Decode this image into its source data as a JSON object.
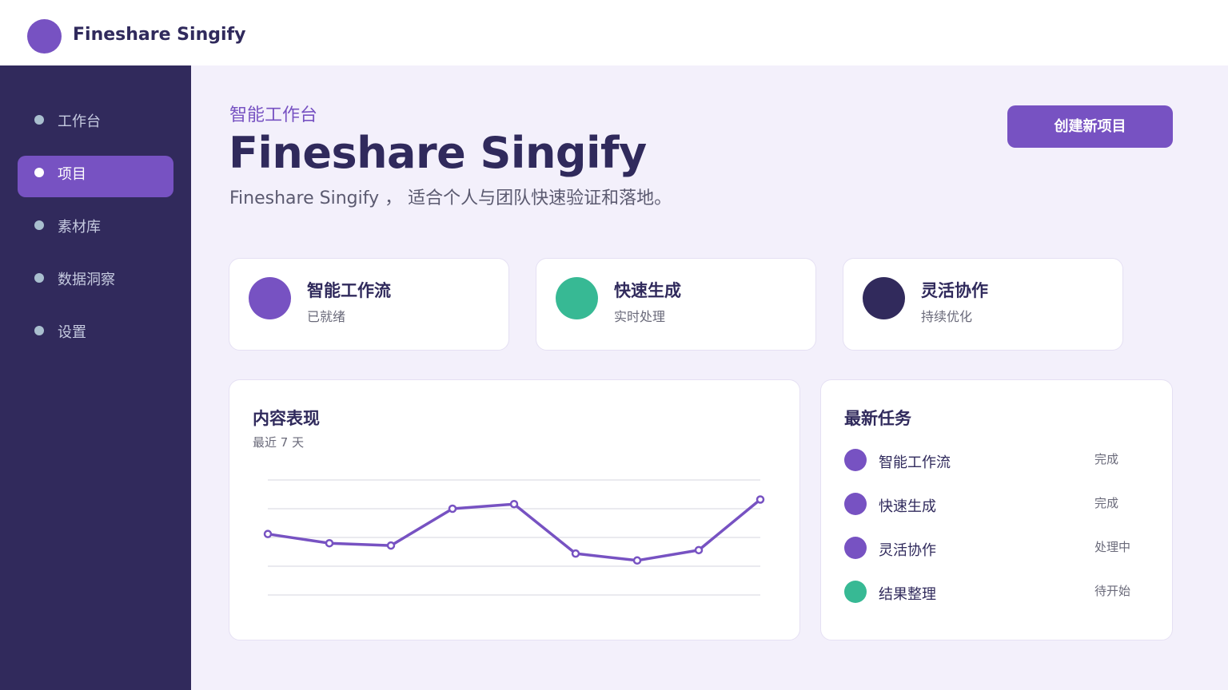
{
  "app": {
    "brand_name": "Fineshare Singify"
  },
  "colors": {
    "accent": "#7752c2",
    "green": "#37b994",
    "navy": "#312a5c",
    "background": "#f3f0fb"
  },
  "sidebar": {
    "items": [
      {
        "label": "工作台",
        "active": false
      },
      {
        "label": "项目",
        "active": true
      },
      {
        "label": "素材库",
        "active": false
      },
      {
        "label": "数据洞察",
        "active": false
      },
      {
        "label": "设置",
        "active": false
      }
    ]
  },
  "header": {
    "eyebrow": "智能工作台",
    "title": "Fineshare Singify",
    "subtitle": "Fineshare Singify ， 适合个人与团队快速验证和落地。",
    "create_label": "创建新项目"
  },
  "stats": [
    {
      "title": "智能工作流",
      "sub": "已就绪",
      "color": "#7752c2"
    },
    {
      "title": "快速生成",
      "sub": "实时处理",
      "color": "#37b994"
    },
    {
      "title": "灵活协作",
      "sub": "持续优化",
      "color": "#312a5c"
    }
  ],
  "performance": {
    "title": "内容表现",
    "subtitle": "最近 7 天"
  },
  "tasks": {
    "title": "最新任务",
    "items": [
      {
        "name": "智能工作流",
        "status": "完成",
        "color": "#7752c2"
      },
      {
        "name": "快速生成",
        "status": "完成",
        "color": "#7752c2"
      },
      {
        "name": "灵活协作",
        "status": "处理中",
        "color": "#7752c2"
      },
      {
        "name": "结果整理",
        "status": "待开始",
        "color": "#37b994"
      }
    ]
  },
  "chart_data": {
    "type": "line",
    "title": "内容表现",
    "subtitle": "最近 7 天",
    "x": [
      1,
      2,
      3,
      4,
      5,
      6,
      7,
      8,
      9
    ],
    "series": [
      {
        "values": [
          53,
          45,
          43,
          75,
          79,
          36,
          30,
          39,
          83
        ],
        "color": "#7752c2"
      }
    ],
    "ylim": [
      0,
      100
    ],
    "grid": true,
    "gridlines": 5,
    "legend": "none"
  }
}
